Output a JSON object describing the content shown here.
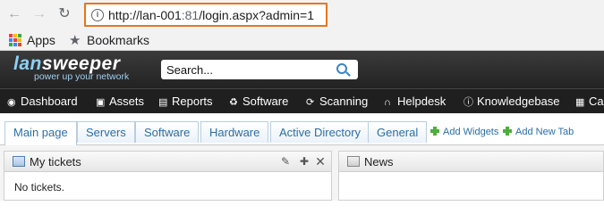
{
  "browser": {
    "url_host": "http://lan-001",
    "url_port": ":81",
    "url_path": "/login.aspx?admin=1",
    "info_symbol": "i"
  },
  "bookmarks_bar": {
    "apps_label": "Apps",
    "bookmarks_label": "Bookmarks",
    "apps_colors": [
      "#ea4335",
      "#fbbc05",
      "#34a853",
      "#4285f4",
      "#ea4335",
      "#fbbc05",
      "#34a853",
      "#4285f4",
      "#ea4335"
    ]
  },
  "logo": {
    "part1": "lan",
    "part2": "sweeper",
    "tagline": "power up your network"
  },
  "search": {
    "value": "Search..."
  },
  "main_nav": {
    "items": [
      {
        "label": "Dashboard",
        "icon": "dashboard-icon"
      },
      {
        "label": "Assets",
        "icon": "assets-icon"
      },
      {
        "label": "Reports",
        "icon": "reports-icon"
      },
      {
        "label": "Software",
        "icon": "software-icon"
      },
      {
        "label": "Scanning",
        "icon": "scanning-icon"
      },
      {
        "label": "Helpdesk",
        "icon": "headset-icon"
      },
      {
        "label": "Knowledgebase",
        "icon": "info-icon"
      },
      {
        "label": "Ca",
        "icon": "calendar-icon"
      }
    ]
  },
  "tabs": {
    "items": [
      "Main page",
      "Servers",
      "Software",
      "Hardware",
      "Active Directory",
      "General"
    ],
    "active_index": 0,
    "add_widgets": "Add Widgets",
    "add_new_tab": "Add New Tab"
  },
  "widgets": {
    "my_tickets": {
      "title": "My tickets",
      "body": "No tickets."
    },
    "news": {
      "title": "News"
    }
  },
  "colors": {
    "accent": "#2a6ea8",
    "highlight_border": "#e8761b",
    "plus_green": "#4caf3a"
  }
}
